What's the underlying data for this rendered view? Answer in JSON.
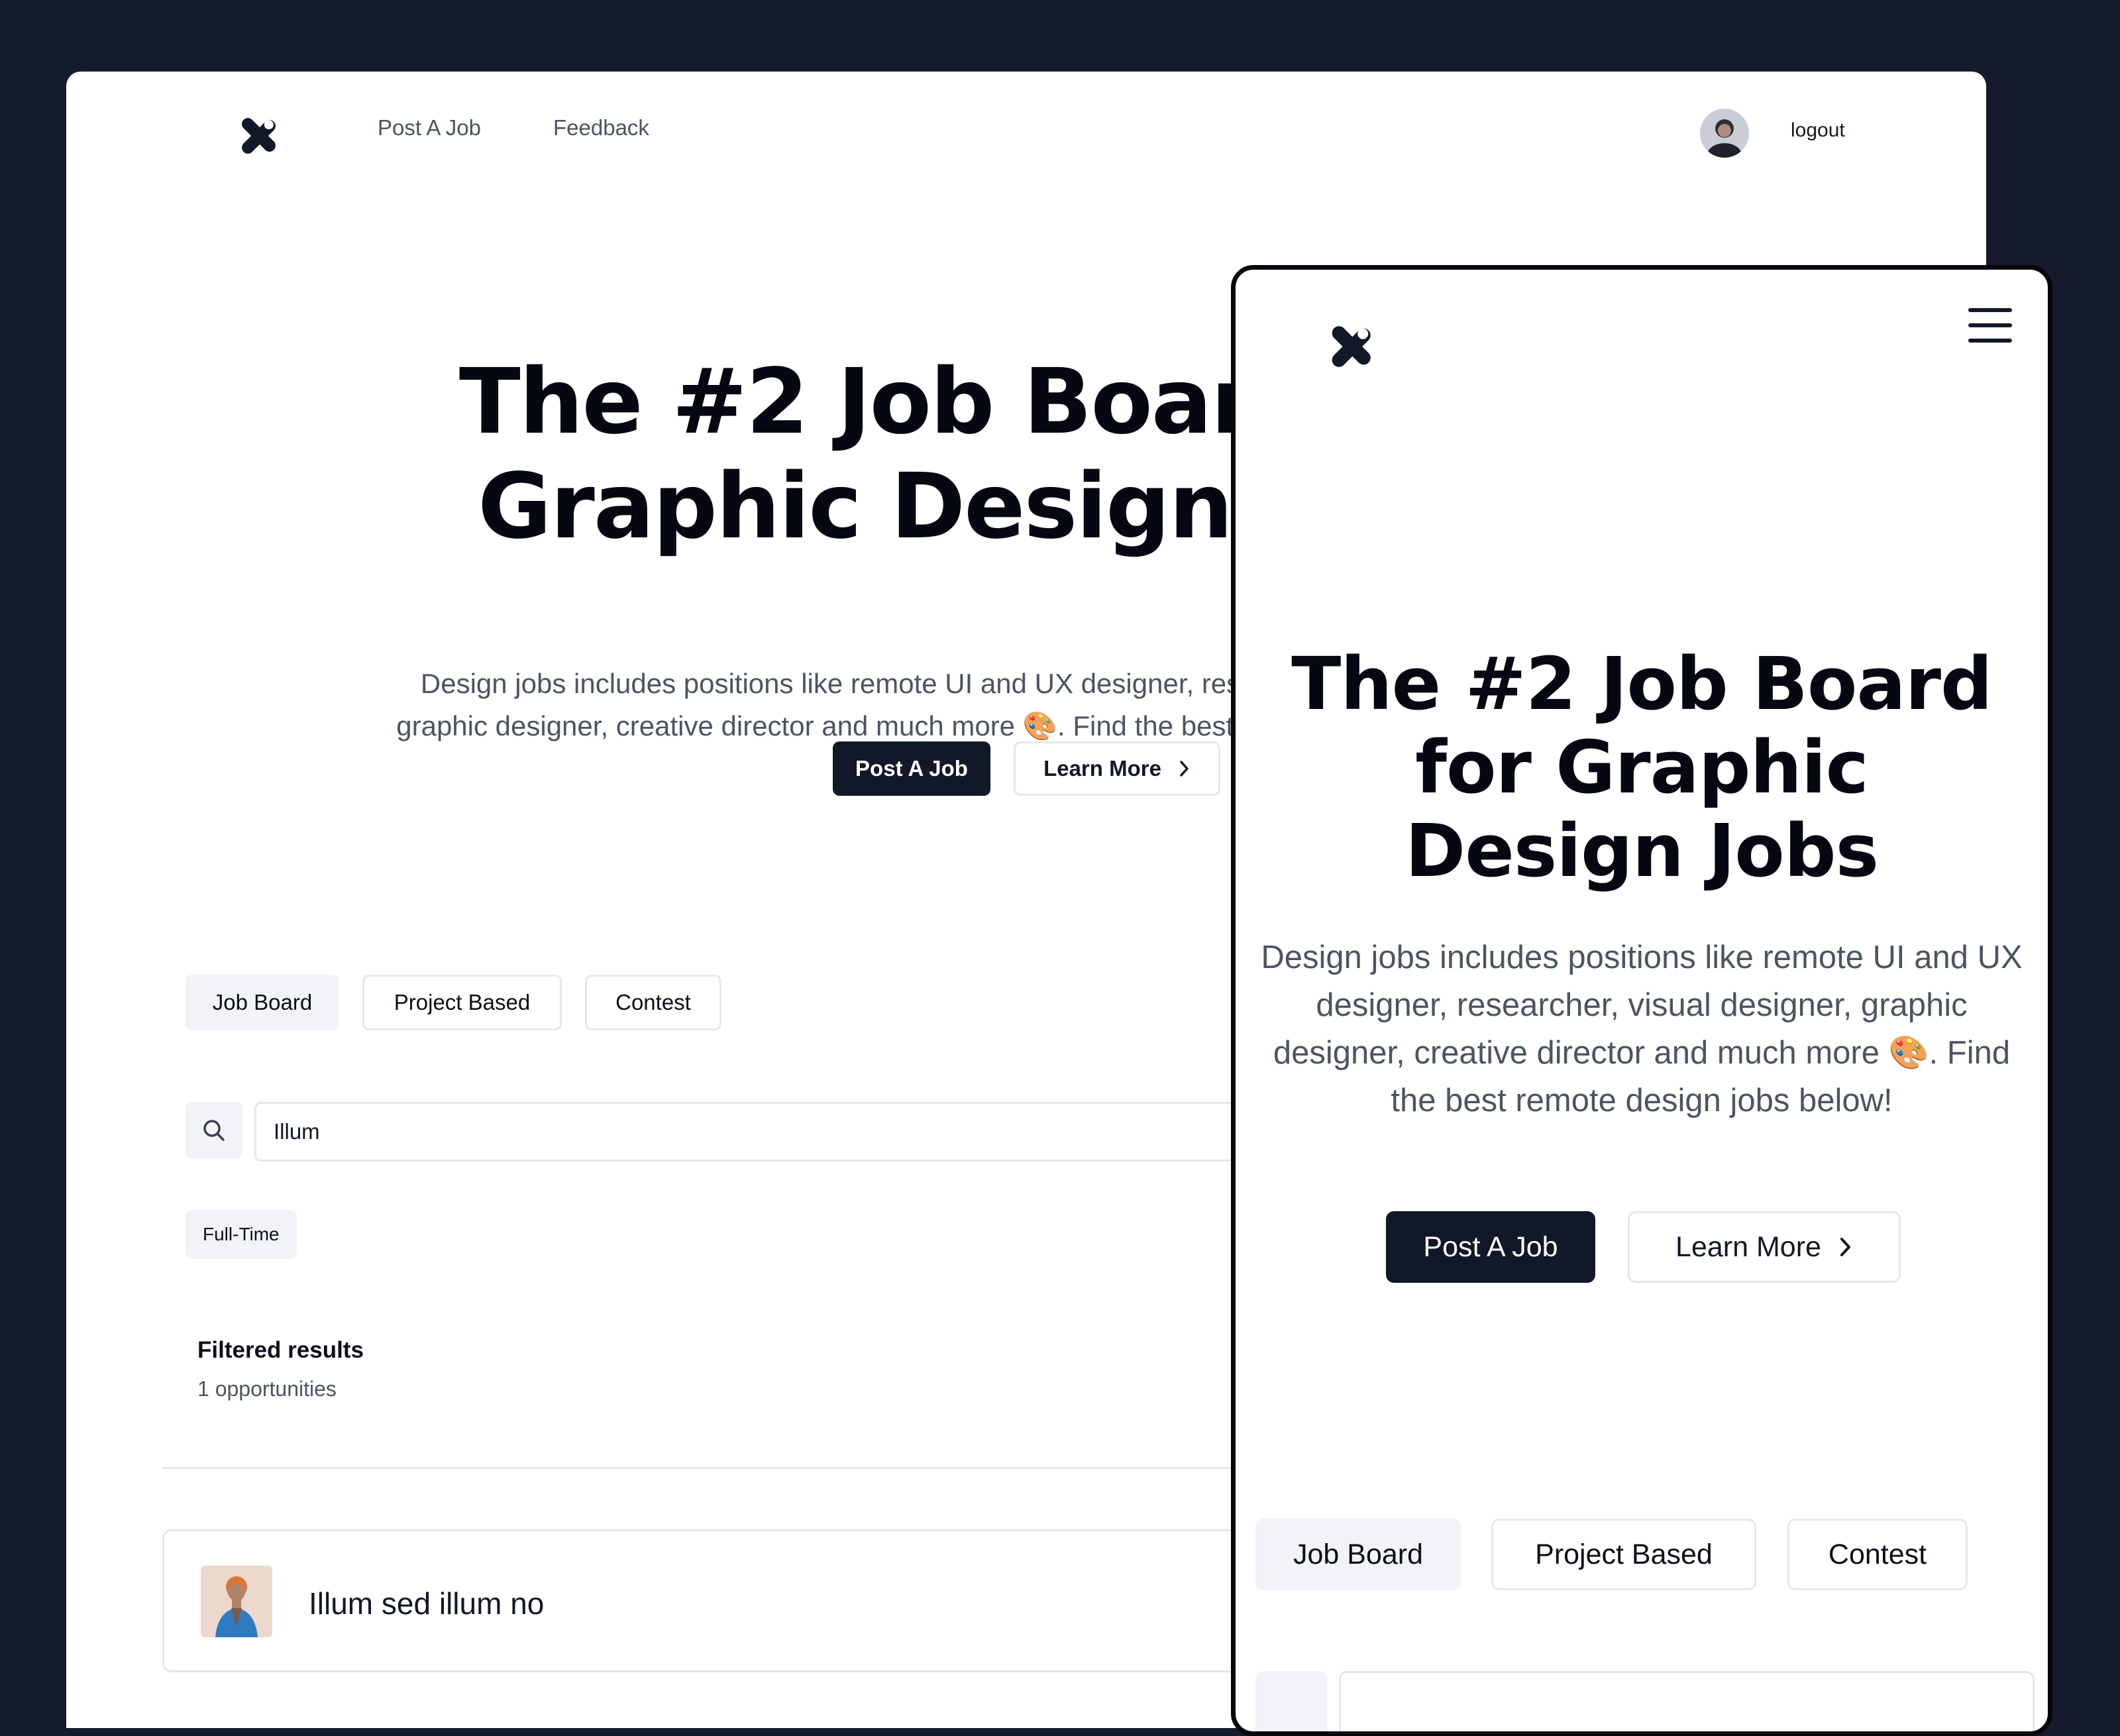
{
  "desktop": {
    "nav": {
      "post_job": "Post A Job",
      "feedback": "Feedback",
      "logout": "logout"
    },
    "hero": {
      "title_line1": "The #2 Job Board for",
      "title_line2": "Graphic Design Jobs",
      "description": "Design jobs includes positions like remote UI and UX designer, researcher, visual designer, graphic designer, creative director and much more 🎨. Find the best remote design jobs below!",
      "post_button": "Post A Job",
      "learn_button": "Learn More"
    },
    "tabs": [
      "Job Board",
      "Project Based",
      "Contest"
    ],
    "search": {
      "value": "Illum"
    },
    "filter_chip": "Full-Time",
    "results": {
      "title": "Filtered results",
      "count": "1 opportunities"
    },
    "jobs": [
      {
        "title": "Illum sed illum no"
      }
    ]
  },
  "mobile": {
    "hero": {
      "title_line1": "The #2 Job Board",
      "title_line2": "for Graphic",
      "title_line3": "Design Jobs",
      "description": "Design jobs includes positions like remote UI and UX designer, researcher, visual designer, graphic designer, creative director and much more 🎨. Find the best remote design jobs below!",
      "post_button": "Post A Job",
      "learn_button": "Learn More"
    },
    "tabs": [
      "Job Board",
      "Project Based",
      "Contest"
    ]
  },
  "icons": {
    "logo": "x-logo-icon",
    "search": "search-icon",
    "chevron": "chevron-right-icon",
    "menu": "hamburger-menu-icon"
  },
  "colors": {
    "background": "#151b2b",
    "primary_button": "#111827",
    "muted_text": "#4b5563",
    "tab_active": "#f1f3f7",
    "border": "#e5e7eb"
  }
}
